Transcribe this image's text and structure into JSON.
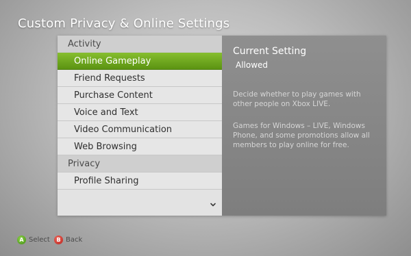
{
  "page": {
    "title": "Custom Privacy & Online Settings"
  },
  "list": {
    "rows": [
      {
        "label": "Activity",
        "kind": "header"
      },
      {
        "label": "Online Gameplay",
        "kind": "item",
        "selected": true
      },
      {
        "label": "Friend Requests",
        "kind": "item"
      },
      {
        "label": "Purchase Content",
        "kind": "item"
      },
      {
        "label": "Voice and Text",
        "kind": "item"
      },
      {
        "label": "Video Communication",
        "kind": "item"
      },
      {
        "label": "Web Browsing",
        "kind": "item"
      },
      {
        "label": "Privacy",
        "kind": "header"
      },
      {
        "label": "Profile Sharing",
        "kind": "item"
      }
    ],
    "scroll_icon": "chevron-down-icon"
  },
  "detail": {
    "title": "Current Setting",
    "value": "Allowed",
    "paragraph1": "Decide whether to play games with other people on Xbox LIVE.",
    "paragraph2": "Games for Windows – LIVE, Windows Phone, and some promotions allow all members to play online for free."
  },
  "footer": {
    "select": {
      "button": "A",
      "label": "Select"
    },
    "back": {
      "button": "B",
      "label": "Back"
    }
  },
  "colors": {
    "selected_green": "#6aa31c",
    "button_a": "#4a9a16",
    "button_b": "#c42a20",
    "detail_bg": "#878787"
  }
}
